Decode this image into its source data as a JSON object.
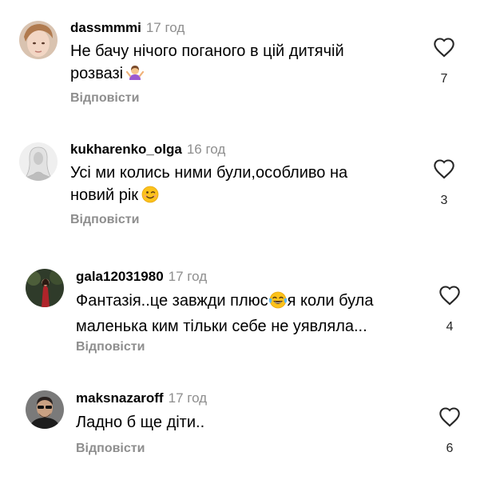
{
  "comments": [
    {
      "username": "dassmmmi",
      "time": "17 год",
      "text_line1": "Не бачу нічого поганого в цій дитячій",
      "text_line2": "розвазі",
      "reply_label": "Відповісти",
      "likes": "7"
    },
    {
      "username": "kukharenko_olga",
      "time": "16 год",
      "text_line1": "Усі ми колись ними були,особливо на",
      "text_line2": "новий рік",
      "reply_label": "Відповісти",
      "likes": "3"
    },
    {
      "username": "gala12031980",
      "time": "17 год",
      "text_line1a": "Фантазія..це завжди плюс",
      "text_line1b": "я коли була",
      "text_line2": "маленька ким тільки себе не уявляла...",
      "reply_label": "Відповісти",
      "likes": "4"
    },
    {
      "username": "maksnazaroff",
      "time": "17 год",
      "text_line1": "Ладно б ще діти..",
      "reply_label": "Відповісти",
      "likes": "6"
    }
  ],
  "icons": {
    "like": "heart-outline-icon",
    "emoji1": "woman-shrugging-emoji",
    "emoji2": "winking-face-emoji",
    "emoji3": "face-with-tears-of-joy-emoji"
  },
  "colors": {
    "text": "#000000",
    "muted": "#8e8e8e"
  }
}
